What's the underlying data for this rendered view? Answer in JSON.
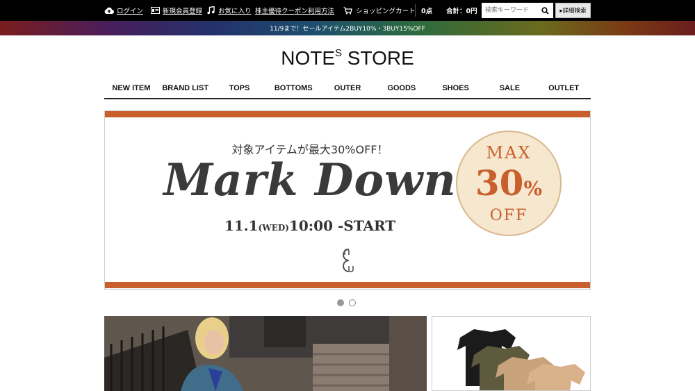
{
  "topbar": {
    "login": "ログイン",
    "register": "新規会員登録",
    "favorites": "お気に入り",
    "coupon": "株主優待クーポン利用方法",
    "cart": "ショッピングカート",
    "cart_count": "0点",
    "cart_total": "合計：0円",
    "search_placeholder": "検索キーワード",
    "advanced_search": "▸詳細検索"
  },
  "promo": {
    "text": "11/9まで！セールアイテム2BUY10%・3BUY15%OFF"
  },
  "logo": {
    "main_1": "NOTE",
    "sup": "S",
    "main_2": " STORE"
  },
  "nav": {
    "items": [
      {
        "label": "NEW ITEM"
      },
      {
        "label": "BRAND LIST"
      },
      {
        "label": "TOPS"
      },
      {
        "label": "BOTTOMS"
      },
      {
        "label": "OUTER"
      },
      {
        "label": "GOODS"
      },
      {
        "label": "SHOES"
      },
      {
        "label": "SALE"
      },
      {
        "label": "OUTLET"
      }
    ]
  },
  "banner": {
    "subtitle": "対象アイテムが最大30%OFF！",
    "title": "Mark Down",
    "date_a": "11.1",
    "date_b": "(WED)",
    "date_c": "10:00 -START",
    "badge_max": "MAX",
    "badge_num": "30",
    "badge_pct": "%",
    "badge_off": "OFF"
  },
  "colors": {
    "accent": "#c85f2c",
    "badge_bg": "#f6e7cf"
  },
  "carousel": {
    "slides": 2,
    "active": 1
  }
}
